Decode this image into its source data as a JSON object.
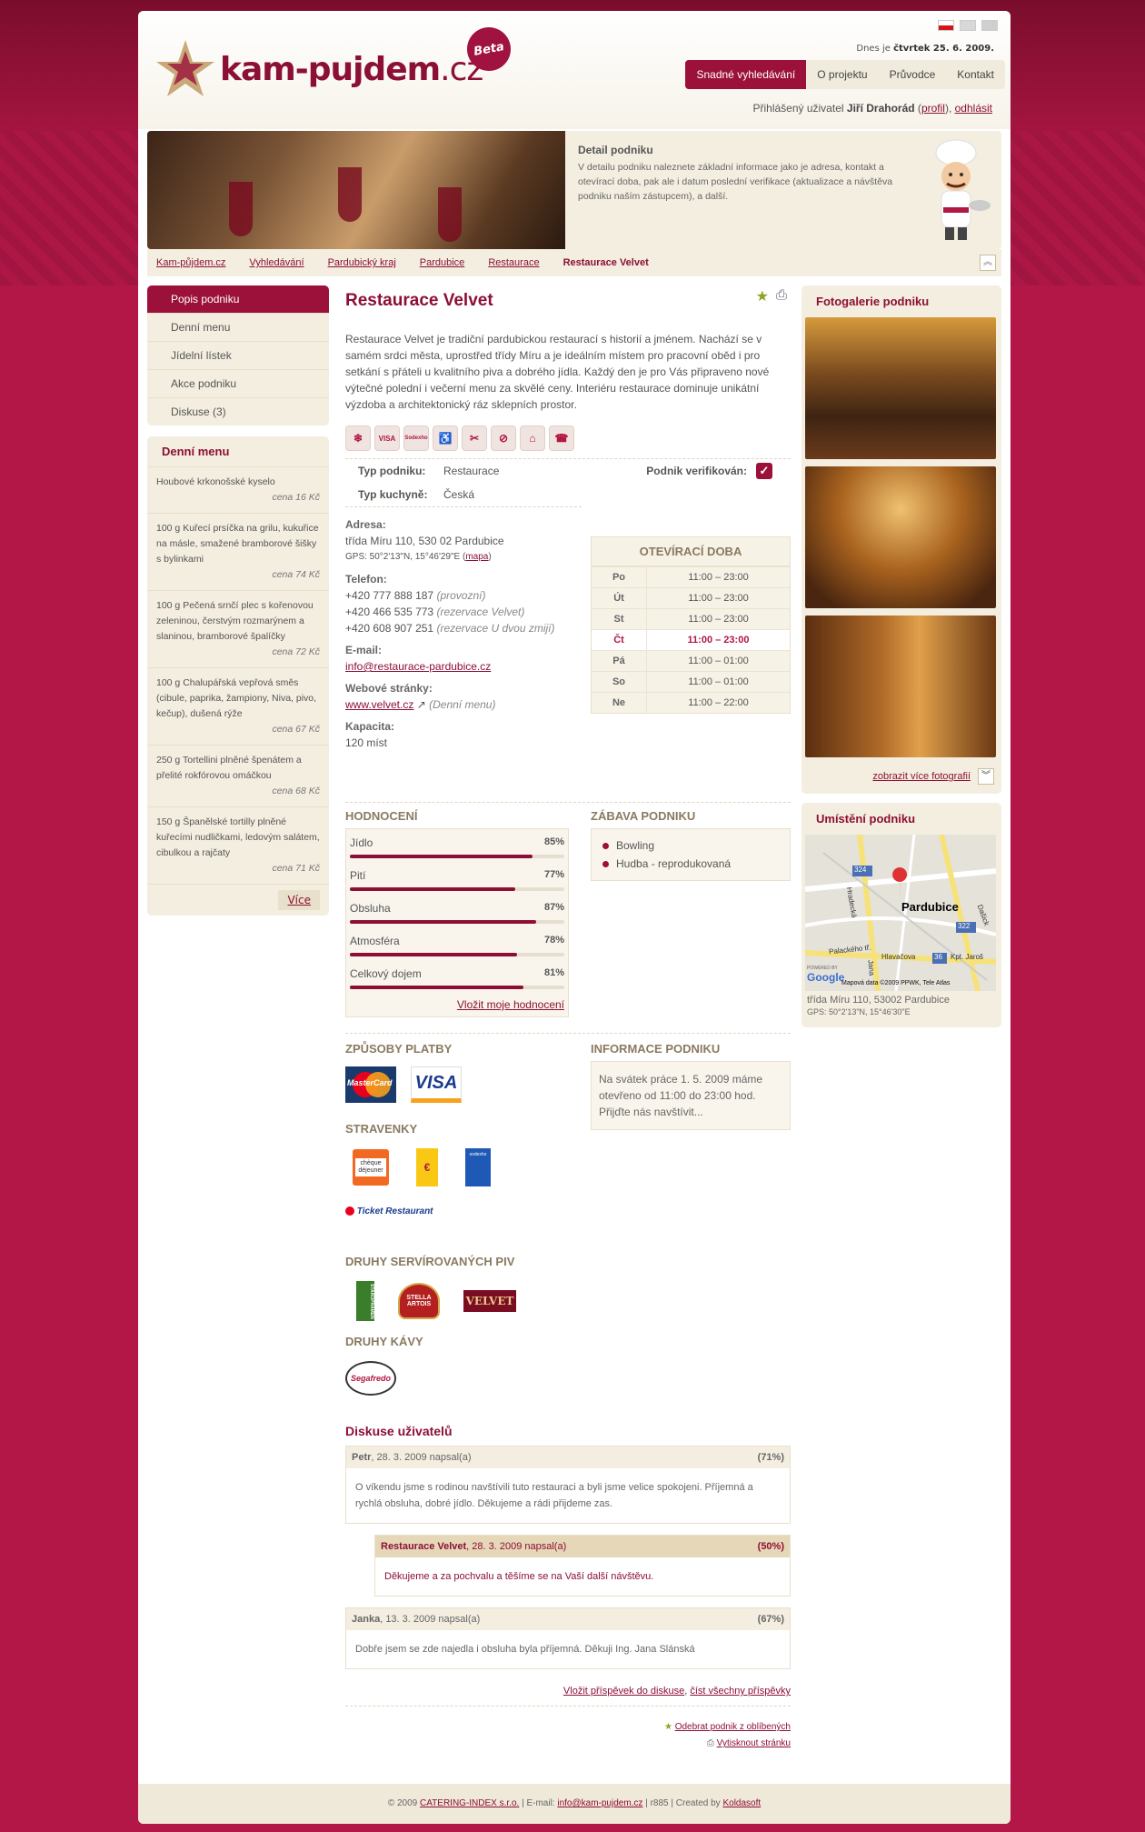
{
  "header": {
    "logo_main": "kam-pujdem",
    "logo_tld": ".cz",
    "beta": "Beta",
    "date_prefix": "Dnes je",
    "date_value": "čtvrtek 25. 6. 2009.",
    "nav": [
      "Snadné vyhledávání",
      "O projektu",
      "Průvodce",
      "Kontakt"
    ],
    "user_prefix": "Přihlášený uživatel",
    "user_name": "Jiří Drahorád",
    "profile": "profil",
    "logout": "odhlásit"
  },
  "banner": {
    "title": "Detail podniku",
    "text": "V detailu podniku naleznete základní informace jako je adresa, kontakt a otevírací doba, pak ale i datum poslední verifikace (aktualizace a návštěva podniku naším zástupcem), a další."
  },
  "breadcrumb": [
    "Kam-půjdem.cz",
    "Vyhledávání",
    "Pardubický kraj",
    "Pardubice",
    "Restaurace",
    "Restaurace Velvet"
  ],
  "sidebar": {
    "menu": [
      "Popis podniku",
      "Denní menu",
      "Jídelní lístek",
      "Akce podniku",
      "Diskuse (3)"
    ],
    "daily_title": "Denní menu",
    "daily": [
      {
        "text": "Houbové krkonošské kyselo",
        "price": "cena 16 Kč"
      },
      {
        "text": "100 g    Kuřecí prsíčka na grilu, kukuřice na másle, smažené bramborové šišky s bylinkami",
        "price": "cena 74 Kč"
      },
      {
        "text": "100 g    Pečená srnčí plec s kořenovou zeleninou, čerstvým rozmarýnem a slaninou, bramborové špalíčky",
        "price": "cena 72 Kč"
      },
      {
        "text": "100 g    Chalupářská vepřová směs (cibule, paprika, žampiony, Niva, pivo, kečup), dušená rýže",
        "price": "cena 67 Kč"
      },
      {
        "text": "250 g    Tortellini plněné špenátem a přelité rokfórovou omáčkou",
        "price": "cena 68 Kč"
      },
      {
        "text": "150 g    Španělské tortilly plněné kuřecími nudličkami, ledovým salátem, cibulkou a rajčaty",
        "price": "cena 71 Kč"
      }
    ],
    "more": "Více"
  },
  "main": {
    "title": "Restaurace Velvet",
    "description": "Restaurace Velvet je tradiční pardubickou restaurací s historií a jménem. Nachází se v samém srdci města, uprostřed třídy Míru a je ideálním místem pro pracovní oběd i pro setkání s přáteli u kvalitního piva a dobrého jídla. Každý den je pro Vás připraveno nové výtečné polední i večerní menu za skvělé ceny. Interiéru restaurace dominuje unikátní výzdoba a architektonický ráz sklepních prostor.",
    "feature_icons": [
      "❄",
      "VISA",
      "Sodexho",
      "♿",
      "✂",
      "⊘",
      "⌂",
      "☎"
    ],
    "type_label": "Typ podniku:",
    "type_value": "Restaurace",
    "verified_label": "Podnik verifikován:",
    "cuisine_label": "Typ kuchyně:",
    "cuisine_value": "Česká",
    "address_label": "Adresa:",
    "address": "třída Míru 110, 530 02 Pardubice",
    "gps": "GPS: 50°2'13\"N, 15°46'29\"E (",
    "map_link": "mapa",
    "phone_label": "Telefon:",
    "phones": [
      {
        "n": "+420 777 888 187",
        "note": "(provozní)"
      },
      {
        "n": "+420 466 535 773",
        "note": "(rezervace Velvet)"
      },
      {
        "n": "+420 608 907 251",
        "note": "(rezervace U dvou zmijí)"
      }
    ],
    "email_label": "E-mail:",
    "email": "info@restaurace-pardubice.cz",
    "web_label": "Webové stránky:",
    "web": "www.velvet.cz",
    "web_note": "(Denní menu)",
    "capacity_label": "Kapacita:",
    "capacity": "120 míst",
    "hours_title": "OTEVÍRACÍ DOBA",
    "hours": [
      {
        "d": "Po",
        "t": "11:00 – 23:00"
      },
      {
        "d": "Út",
        "t": "11:00 – 23:00"
      },
      {
        "d": "St",
        "t": "11:00 – 23:00"
      },
      {
        "d": "Čt",
        "t": "11:00 – 23:00"
      },
      {
        "d": "Pá",
        "t": "11:00 – 01:00"
      },
      {
        "d": "So",
        "t": "11:00 – 01:00"
      },
      {
        "d": "Ne",
        "t": "11:00 – 22:00"
      }
    ],
    "ratings_title": "HODNOCENÍ",
    "ratings": [
      {
        "k": "Jídlo",
        "v": "85%",
        "p": 85
      },
      {
        "k": "Pití",
        "v": "77%",
        "p": 77
      },
      {
        "k": "Obsluha",
        "v": "87%",
        "p": 87
      },
      {
        "k": "Atmosféra",
        "v": "78%",
        "p": 78
      },
      {
        "k": "Celkový dojem",
        "v": "81%",
        "p": 81
      }
    ],
    "rate_link": "Vložit moje hodnocení",
    "fun_title": "ZÁBAVA PODNIKU",
    "fun": [
      "Bowling",
      "Hudba - reprodukovaná"
    ],
    "pay_title": "ZPŮSOBY PLATBY",
    "pay": [
      "MasterCard",
      "VISA"
    ],
    "info_title": "INFORMACE PODNIKU",
    "info": "Na svátek práce 1. 5. 2009 máme otevřeno od 11:00 do 23:00 hod. Přijďte nás navštívit...",
    "vouchers_title": "STRAVENKY",
    "vouchers": [
      "chèque déjeuner",
      "€",
      "sodexho",
      "Ticket Restaurant"
    ],
    "beer_title": "DRUHY SERVÍROVANÝCH PIV",
    "beers": [
      "STAROPRAMEN",
      "STELLA ARTOIS",
      "VELVET"
    ],
    "coffee_title": "DRUHY KÁVY",
    "coffee": "Segafredo",
    "discussion_title": "Diskuse uživatelů",
    "posts": [
      {
        "author": "Petr",
        "meta": ", 28. 3. 2009 napsal(a)",
        "score": "(71%)",
        "text": "O víkendu jsme s rodinou navštívili tuto restauraci a byli jsme velice spokojeni. Příjemná a rychlá obsluha, dobré jídlo. Děkujeme a rádi přijdeme zas."
      },
      {
        "author": "Restaurace Velvet",
        "meta": ", 28. 3. 2009 napsal(a)",
        "score": "(50%)",
        "text": "Děkujeme a za pochvalu a těšíme se na Vaší další návštěvu."
      },
      {
        "author": "Janka",
        "meta": ", 13. 3. 2009 napsal(a)",
        "score": "(67%)",
        "text": "Dobře jsem se zde najedla i obsluha byla příjemná. Děkuji Ing. Jana Slánská"
      }
    ],
    "add_post": "Vložit příspěvek do diskuse",
    "read_all": "číst všechny příspěvky",
    "remove_fav": "Odebrat podnik z oblíbených",
    "print": "Vytisknout stránku"
  },
  "right": {
    "gallery_title": "Fotogalerie podniku",
    "more_photos": "zobrazit více fotografií",
    "location_title": "Umístění podniku",
    "map_city": "Pardubice",
    "map_labels": [
      "324",
      "322",
      "36",
      "Hlavačova",
      "Palackého tř.",
      "Kpt. Jaroš",
      "Hradecká",
      "Jana",
      "Dašick"
    ],
    "map_copyright": "Mapová data ©2009 PPWK, Tele Atlas",
    "map_brand": "Google",
    "map_powered": "POWERED BY",
    "address": "třída Míru 110, 53002 Pardubice",
    "gps": "GPS: 50°2'13\"N, 15°46'30\"E"
  },
  "footer": {
    "copy": "© 2009",
    "company": "CATERING-INDEX s.r.o.",
    "email_prefix": "| E-mail:",
    "email": "info@kam-pujdem.cz",
    "rev": "| r885 | Created by",
    "creator": "Koldasoft"
  },
  "colors": {
    "accent": "#9b1139",
    "background": "#b31748",
    "panel": "#f4eee0"
  }
}
